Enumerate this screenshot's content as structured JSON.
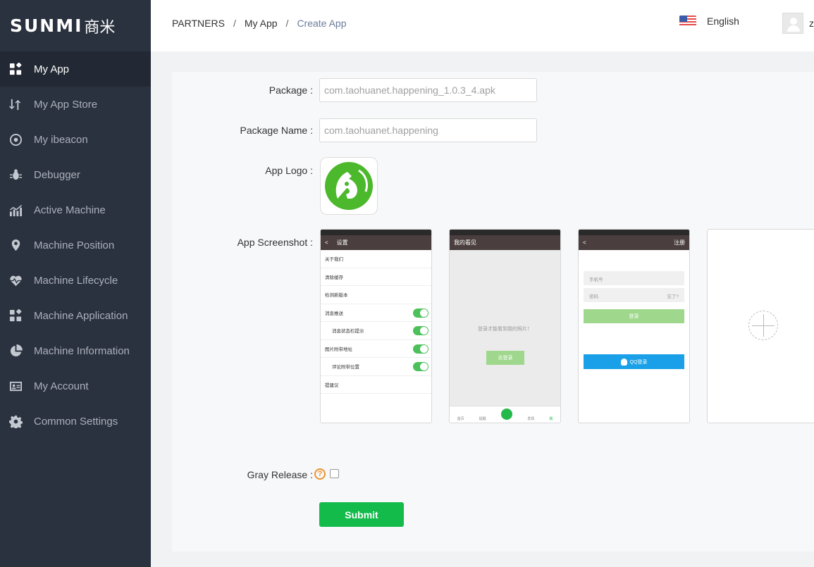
{
  "brand": {
    "logo_en": "SUNMI",
    "logo_cn": "商米"
  },
  "sidebar": {
    "items": [
      {
        "label": "My App",
        "icon": "apps-icon",
        "active": true
      },
      {
        "label": "My App Store",
        "icon": "store-icon"
      },
      {
        "label": "My ibeacon",
        "icon": "beacon-icon"
      },
      {
        "label": "Debugger",
        "icon": "bug-icon"
      },
      {
        "label": "Active Machine",
        "icon": "chart-icon"
      },
      {
        "label": "Machine Position",
        "icon": "location-icon"
      },
      {
        "label": "Machine Lifecycle",
        "icon": "heartbeat-icon"
      },
      {
        "label": "Machine Application",
        "icon": "apps-icon"
      },
      {
        "label": "Machine Information",
        "icon": "pie-icon"
      },
      {
        "label": "My Account",
        "icon": "id-card-icon"
      },
      {
        "label": "Common Settings",
        "icon": "gear-icon"
      }
    ]
  },
  "header": {
    "breadcrumb": [
      "PARTNERS",
      "My App",
      "Create App"
    ],
    "language": "English",
    "user_initial": "z"
  },
  "form": {
    "package_label": "Package :",
    "package_value": "com.taohuanet.happening_1.0.3_4.apk",
    "package_name_label": "Package Name :",
    "package_name_value": "com.taohuanet.happening",
    "app_logo_label": "App Logo :",
    "app_screenshot_label": "App Screenshot :",
    "gray_release_label": "Gray Release :",
    "help_glyph": "?",
    "submit_label": "Submit"
  },
  "screenshots": {
    "s1": {
      "title": "设置",
      "rows": [
        "关于我们",
        "清除缓存",
        "检测新版本",
        "消息推送",
        "消息状态栏提示",
        "图片附带地址",
        "评论附带位置",
        "提建议"
      ]
    },
    "s2": {
      "title": "我的看见",
      "message": "登录才能看到我的照片！",
      "button": "去登录",
      "tabs": [
        "首页",
        "提醒",
        "发现",
        "我"
      ]
    },
    "s3": {
      "title": "注册",
      "phone": "手机号",
      "password": "密码",
      "forgot": "忘了?",
      "login": "登录",
      "qq": "QQ登录"
    }
  },
  "colors": {
    "sidebar_bg": "#2b323f",
    "accent_green": "#13bb4b",
    "help_orange": "#f0932b"
  }
}
